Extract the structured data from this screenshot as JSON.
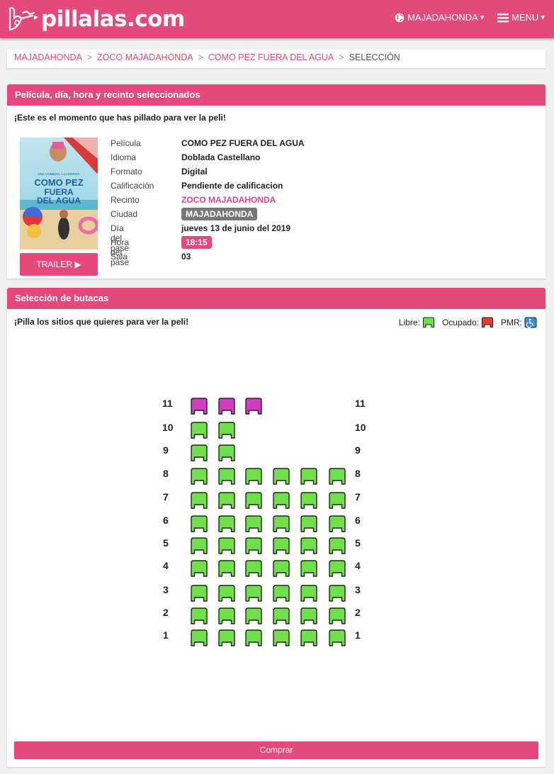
{
  "brand": {
    "name": "pillalas.com"
  },
  "nav": {
    "city": "MAJADAHONDA",
    "city_caret": "▾",
    "menu": "MENU",
    "menu_caret": "▾"
  },
  "breadcrumb": {
    "items": [
      "MAJADAHONDA",
      "ZOCO MAJADAHONDA",
      "COMO PEZ FUERA DEL AGUA"
    ],
    "separator": ">",
    "current": "SELECCIÓN"
  },
  "session": {
    "title": "Película, día, hora y recinto seleccionados",
    "intro": "¡Este es el momento que has pillado para ver la peli!",
    "poster": {
      "tagline": "UNA COMEDIA A LA DERIVA",
      "title_line1": "COMO PEZ",
      "title_line2": "FUERA",
      "title_line3": "DEL AGUA"
    },
    "trailer_label": "TRAILER",
    "trailer_icon": "▶",
    "details": {
      "pelicula_label": "Película",
      "pelicula": "COMO PEZ FUERA DEL AGUA",
      "idioma_label": "Idioma",
      "idioma": "Doblada Castellano",
      "formato_label": "Formato",
      "formato": "Digital",
      "calificacion_label": "Calificación",
      "calificacion": "Pendiente de calificacion",
      "recinto_label": "Recinto",
      "recinto": "ZOCO MAJADAHONDA",
      "ciudad_label": "Ciudad",
      "ciudad": "MAJADAHONDA",
      "dia_label": "Día del pase",
      "dia": "jueves 13 de junio del 2019",
      "hora_label": "Hora del pase",
      "hora": "18:15",
      "sala_label": "Sala",
      "sala": "03"
    }
  },
  "seats": {
    "title": "Selección de butacas",
    "intro": "¡Pilla los sitios que quieres para ver la peli!",
    "legend": {
      "libre": "Libre:",
      "ocupado": "Ocupado:",
      "pmr": "PMR:"
    },
    "colors": {
      "libre": "#6fe04a",
      "ocupado": "#e83a2f",
      "pmr": "#3a8fd8",
      "special": "#d23ec0",
      "accent": "#e5487a"
    },
    "rows": [
      {
        "label": "11",
        "seats": [
          "special",
          "special",
          "special",
          null,
          null,
          null
        ]
      },
      {
        "label": "10",
        "seats": [
          "libre",
          "libre",
          null,
          null,
          null,
          null
        ]
      },
      {
        "label": "9",
        "seats": [
          "libre",
          "libre",
          null,
          null,
          null,
          null
        ]
      },
      {
        "label": "8",
        "seats": [
          "libre",
          "libre",
          "libre",
          "libre",
          "libre",
          "libre"
        ]
      },
      {
        "label": "7",
        "seats": [
          "libre",
          "libre",
          "libre",
          "libre",
          "libre",
          "libre"
        ]
      },
      {
        "label": "6",
        "seats": [
          "libre",
          "libre",
          "libre",
          "libre",
          "libre",
          "libre"
        ]
      },
      {
        "label": "5",
        "seats": [
          "libre",
          "libre",
          "libre",
          "libre",
          "libre",
          "libre"
        ]
      },
      {
        "label": "4",
        "seats": [
          "libre",
          "libre",
          "libre",
          "libre",
          "libre",
          "libre"
        ]
      },
      {
        "label": "3",
        "seats": [
          "libre",
          "libre",
          "libre",
          "libre",
          "libre",
          "libre"
        ]
      },
      {
        "label": "2",
        "seats": [
          "libre",
          "libre",
          "libre",
          "libre",
          "libre",
          "libre"
        ]
      },
      {
        "label": "1",
        "seats": [
          "libre",
          "libre",
          "libre",
          "libre",
          "libre",
          "libre"
        ]
      }
    ],
    "buy_label": "Comprar"
  }
}
